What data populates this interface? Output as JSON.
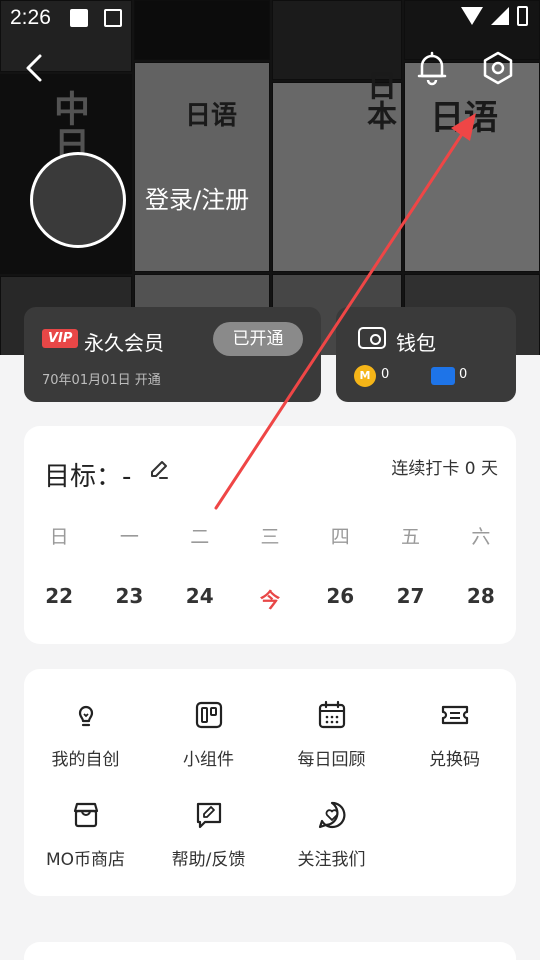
{
  "status_bar": {
    "time": "2:26"
  },
  "header": {
    "back_icon": "chevron-left-icon",
    "notification_icon": "bell-icon",
    "settings_icon": "hexagon-gear-icon",
    "login_label": "登录/注册",
    "book_titles": [
      "日语",
      "日本",
      "日语",
      "中日"
    ]
  },
  "vip": {
    "badge": "VIP",
    "title": "永久会员",
    "status_button": "已开通",
    "date_text": "70年01月01日 开通"
  },
  "wallet": {
    "title": "钱包",
    "coin_symbol": "M",
    "coin_count": "0",
    "ticket_count": "0"
  },
  "goal": {
    "title": "目标：-",
    "streak": "连续打卡 0 天",
    "weekdays": [
      "日",
      "一",
      "二",
      "三",
      "四",
      "五",
      "六"
    ],
    "dates": [
      "22",
      "23",
      "24",
      "今",
      "26",
      "27",
      "28"
    ]
  },
  "features": [
    {
      "label": "我的自创",
      "icon": "lightbulb-icon"
    },
    {
      "label": "小组件",
      "icon": "widget-icon"
    },
    {
      "label": "每日回顾",
      "icon": "calendar-icon"
    },
    {
      "label": "兑换码",
      "icon": "ticket-icon"
    },
    {
      "label": "MO币商店",
      "icon": "store-icon"
    },
    {
      "label": "帮助/反馈",
      "icon": "feedback-icon"
    },
    {
      "label": "关注我们",
      "icon": "heart-chat-icon"
    }
  ],
  "colors": {
    "accent_red": "#e84747",
    "coin_gold": "#f5b518",
    "ticket_blue": "#1e74e8",
    "card_dark": "#3a3a3a"
  }
}
